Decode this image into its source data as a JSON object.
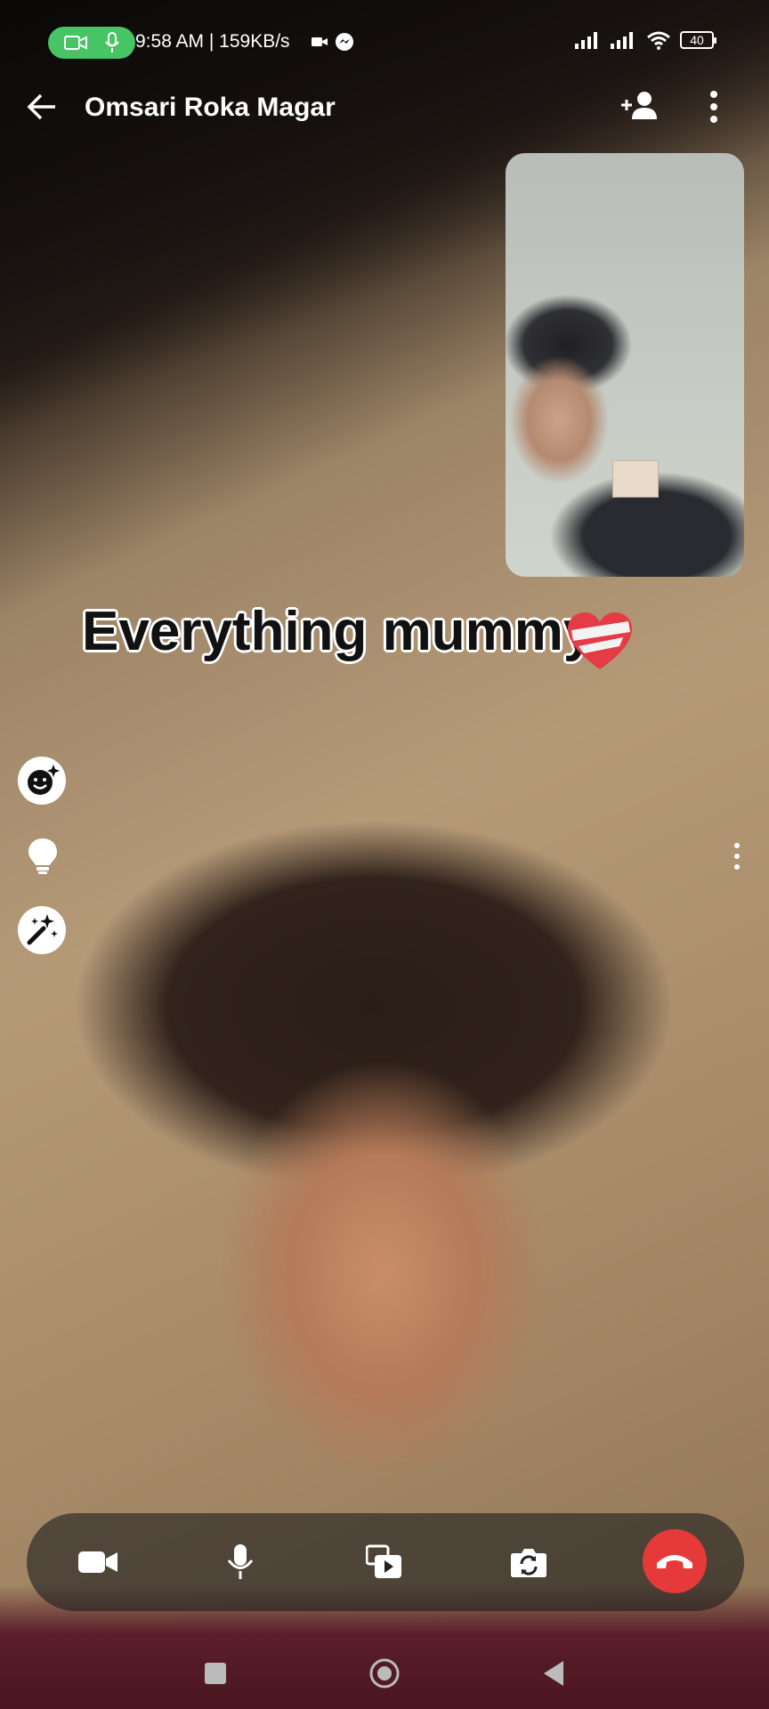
{
  "status_bar": {
    "time_speed": "9:58 AM | 159KB/s",
    "battery": "40"
  },
  "header": {
    "title": "Omsari Roka Magar"
  },
  "caption": {
    "text": "Everything mummy"
  },
  "icons": {
    "back": "arrow-left-icon",
    "add_person": "add-person-icon",
    "more": "more-vert-icon",
    "effects": "face-sparkle-icon",
    "lighting": "lightbulb-icon",
    "magic": "magic-wand-icon",
    "camera": "video-camera-icon",
    "mic": "microphone-icon",
    "share": "share-media-icon",
    "flip": "camera-flip-icon",
    "end": "end-call-icon"
  },
  "colors": {
    "call_pill": "#47c463",
    "end_call": "#e63a3a",
    "heart": "#e53b47"
  }
}
